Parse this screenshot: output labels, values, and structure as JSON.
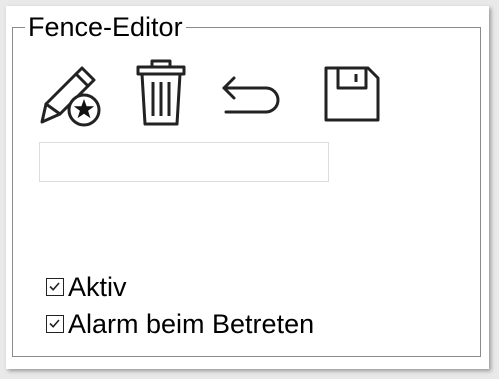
{
  "editor": {
    "title": "Fence-Editor",
    "tools": [
      {
        "name": "edit-fence",
        "icon": "pencil-star-icon"
      },
      {
        "name": "delete-fence",
        "icon": "trash-icon"
      },
      {
        "name": "undo",
        "icon": "undo-arrow-icon"
      },
      {
        "name": "save",
        "icon": "floppy-disk-icon"
      }
    ],
    "name_field": {
      "value": "",
      "placeholder": ""
    },
    "checkboxes": {
      "active": {
        "label": "Aktiv",
        "checked": true
      },
      "alarm_on_enter": {
        "label": "Alarm beim Betreten",
        "checked": true
      }
    }
  }
}
